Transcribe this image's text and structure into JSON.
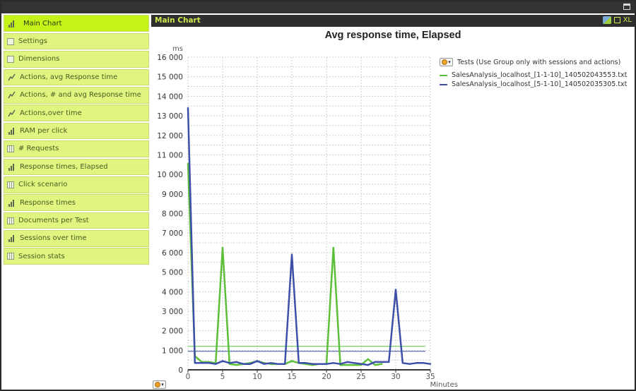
{
  "window": {
    "maximize_icon": "maximize-icon"
  },
  "sidebar": {
    "items": [
      {
        "label": "Main Chart",
        "icon": "bar-chart-icon",
        "active": true
      },
      {
        "label": "Settings",
        "icon": "form-icon"
      },
      {
        "label": "Dimensions",
        "icon": "form-icon"
      },
      {
        "label": "Actions, avg Response time",
        "icon": "line-chart-icon"
      },
      {
        "label": "Actions, # and avg Response time",
        "icon": "line-chart-icon"
      },
      {
        "label": "Actions,over time",
        "icon": "line-chart-icon"
      },
      {
        "label": "RAM per click",
        "icon": "bar-chart-icon"
      },
      {
        "label": "# Requests",
        "icon": "table-icon"
      },
      {
        "label": "Response times, Elapsed",
        "icon": "bar-chart-icon"
      },
      {
        "label": "Click scenario",
        "icon": "table-icon"
      },
      {
        "label": "Response times",
        "icon": "bar-chart-icon"
      },
      {
        "label": "Documents per Test",
        "icon": "table-icon"
      },
      {
        "label": "Sessions over time",
        "icon": "bar-chart-icon"
      },
      {
        "label": "Session stats",
        "icon": "table-icon"
      }
    ]
  },
  "main": {
    "title": "Main Chart",
    "tools": {
      "export_icon": "export-icon",
      "print_icon": "print-icon",
      "xl_label": "XL"
    }
  },
  "legend": {
    "title": "Tests (Use Group only with sessions and actions)"
  },
  "chart_data": {
    "type": "line",
    "title": "Avg response time, Elapsed",
    "xlabel": "Minutes",
    "ylabel": "ms",
    "xlim": [
      0,
      35
    ],
    "ylim": [
      0,
      16000
    ],
    "x_ticks": [
      "0",
      "5",
      "10",
      "15",
      "20",
      "25",
      "30",
      "35"
    ],
    "y_ticks": [
      "0",
      "1 000",
      "2 000",
      "3 000",
      "4 000",
      "5 000",
      "6 000",
      "7 000",
      "8 000",
      "9 000",
      "10 000",
      "11 000",
      "12 000",
      "13 000",
      "14 000",
      "15 000",
      "16 000"
    ],
    "grid": true,
    "legend_position": "right",
    "series": [
      {
        "name": "SalesAnalysis_localhost_[1-1-10]_140502043553.txt",
        "color": "#5cbf3a",
        "average": 1200,
        "x": [
          0,
          1,
          2,
          3,
          4,
          5,
          6,
          7,
          8,
          9,
          10,
          11,
          12,
          13,
          14,
          15,
          16,
          17,
          18,
          19,
          20,
          21,
          22,
          23,
          24,
          25,
          26,
          27,
          28
        ],
        "y": [
          10550,
          700,
          400,
          400,
          350,
          6250,
          300,
          250,
          300,
          350,
          450,
          350,
          300,
          300,
          300,
          450,
          350,
          300,
          250,
          300,
          300,
          6250,
          250,
          250,
          250,
          250,
          550,
          250,
          300
        ]
      },
      {
        "name": "SalesAnalysis_localhost_[5-1-10]_140502035305.txt",
        "color": "#3d4fa8",
        "average": 950,
        "x": [
          0,
          1,
          2,
          3,
          4,
          5,
          6,
          7,
          8,
          9,
          10,
          11,
          12,
          13,
          14,
          15,
          16,
          17,
          18,
          19,
          20,
          21,
          22,
          23,
          24,
          25,
          26,
          27,
          28,
          29,
          30,
          31,
          32,
          33,
          34,
          35
        ],
        "y": [
          13400,
          350,
          350,
          350,
          300,
          450,
          350,
          400,
          300,
          300,
          450,
          300,
          350,
          300,
          300,
          5900,
          350,
          350,
          300,
          300,
          300,
          350,
          300,
          400,
          350,
          300,
          250,
          400,
          400,
          400,
          4100,
          350,
          300,
          350,
          350,
          300
        ]
      }
    ]
  }
}
